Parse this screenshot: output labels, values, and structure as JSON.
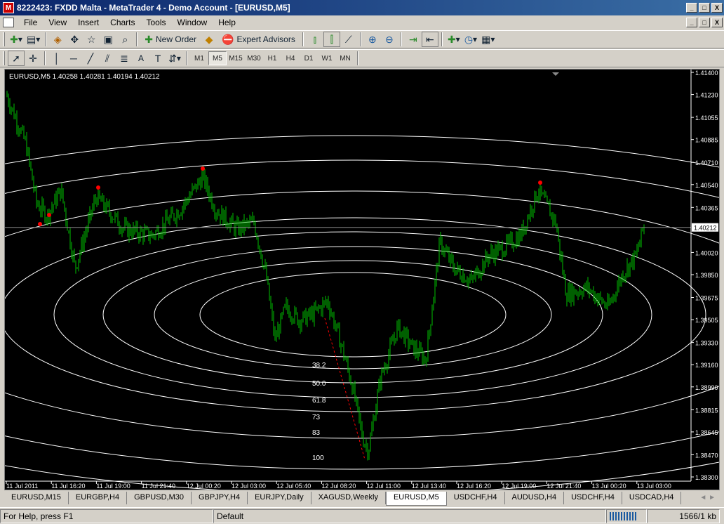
{
  "window": {
    "title": "8222423: FXDD Malta - MetaTrader 4 - Demo Account - [EURUSD,M5]",
    "app_icon": "metatrader-icon",
    "min_label": "_",
    "max_label": "□",
    "close_label": "X"
  },
  "menu": {
    "items": [
      "File",
      "View",
      "Insert",
      "Charts",
      "Tools",
      "Window",
      "Help"
    ],
    "mdi_min": "_",
    "mdi_restore": "□",
    "mdi_close": "X"
  },
  "toolbar": {
    "new_order": "New Order",
    "expert_advisors": "Expert Advisors",
    "timeframes": [
      "M1",
      "M5",
      "M15",
      "M30",
      "H1",
      "H4",
      "D1",
      "W1",
      "MN"
    ],
    "active_timeframe": "M5",
    "text_tool": "A"
  },
  "chart": {
    "info": "EURUSD,M5  1.40258 1.40281 1.40194 1.40212",
    "current_price": "1.40212",
    "y_ticks": [
      "1.41400",
      "1.41230",
      "1.41055",
      "1.40885",
      "1.40710",
      "1.40540",
      "1.40365",
      "1.40020",
      "1.39850",
      "1.39675",
      "1.39505",
      "1.39330",
      "1.39160",
      "1.38990",
      "1.38815",
      "1.38645",
      "1.38470",
      "1.38300"
    ],
    "x_ticks": [
      "11 Jul 2011",
      "11 Jul 16:20",
      "11 Jul 19:00",
      "11 Jul 21:40",
      "12 Jul 00:20",
      "12 Jul 03:00",
      "12 Jul 05:40",
      "12 Jul 08:20",
      "12 Jul 11:00",
      "12 Jul 13:40",
      "12 Jul 16:20",
      "12 Jul 19:00",
      "12 Jul 21:40",
      "13 Jul 00:20",
      "13 Jul 03:00"
    ],
    "fib_levels": [
      "38.2",
      "50.0",
      "61.8",
      "73",
      "83",
      "100"
    ],
    "colors": {
      "background": "#000000",
      "candles": "#00c000",
      "ellipses": "#ffffff",
      "fractals": "#ff0000",
      "trendline": "#ff0000"
    }
  },
  "chart_data": {
    "type": "line",
    "series": [],
    "x": [
      "11 Jul 2011",
      "11 Jul 16:20",
      "11 Jul 19:00",
      "11 Jul 21:40",
      "12 Jul 00:20",
      "12 Jul 03:00",
      "12 Jul 05:40",
      "12 Jul 08:20",
      "12 Jul 11:00",
      "12 Jul 13:40",
      "12 Jul 16:20",
      "12 Jul 19:00",
      "12 Jul 21:40",
      "13 Jul 00:20",
      "13 Jul 03:00"
    ],
    "y_approx_close": [
      1.4123,
      1.4042,
      1.4045,
      1.4022,
      1.406,
      1.4005,
      1.3965,
      1.3962,
      1.39,
      1.401,
      1.399,
      1.4045,
      1.397,
      1.3955,
      1.4021
    ],
    "ylim": [
      1.383,
      1.414
    ],
    "fib_ellipse_levels": [
      38.2,
      50.0,
      61.8,
      73,
      83,
      100
    ],
    "grid": false
  },
  "tabs": {
    "items": [
      "EURUSD,M15",
      "EURGBP,H4",
      "GBPUSD,M30",
      "GBPJPY,H4",
      "EURJPY,Daily",
      "XAGUSD,Weekly",
      "EURUSD,M5",
      "USDCHF,H4",
      "AUDUSD,H4",
      "USDCHF,H4",
      "USDCAD,H4"
    ],
    "active": "EURUSD,M5",
    "arrows": "◄ ►"
  },
  "status": {
    "help": "For Help, press F1",
    "profile": "Default",
    "traffic": "1566/1 kb"
  }
}
